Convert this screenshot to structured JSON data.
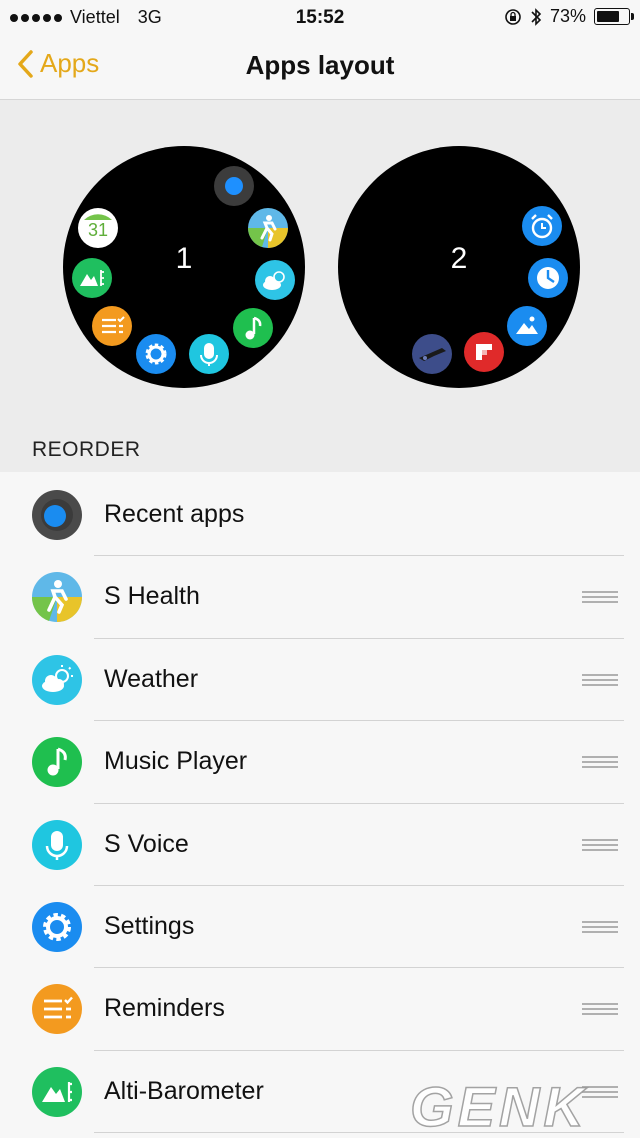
{
  "status_bar": {
    "carrier": "Viettel",
    "network": "3G",
    "time": "15:52",
    "battery": "73%",
    "battery_level": 0.73
  },
  "nav": {
    "back_label": "Apps",
    "title": "Apps layout"
  },
  "watches": [
    {
      "page": "1"
    },
    {
      "page": "2"
    }
  ],
  "section_header": "REORDER",
  "calendar_day": "31",
  "apps": [
    {
      "label": "Recent apps",
      "icon": "recent-apps-icon",
      "color": "#4a4a4a",
      "reorderable": false
    },
    {
      "label": "S Health",
      "icon": "s-health-icon",
      "color": "#5fb8e8",
      "reorderable": true
    },
    {
      "label": "Weather",
      "icon": "weather-icon",
      "color": "#2ec4e6",
      "reorderable": true
    },
    {
      "label": "Music Player",
      "icon": "music-player-icon",
      "color": "#1fbf4f",
      "reorderable": true
    },
    {
      "label": "S Voice",
      "icon": "s-voice-icon",
      "color": "#1fc6e0",
      "reorderable": true
    },
    {
      "label": "Settings",
      "icon": "settings-icon",
      "color": "#1a8cf0",
      "reorderable": true
    },
    {
      "label": "Reminders",
      "icon": "reminders-icon",
      "color": "#f39a1f",
      "reorderable": true
    },
    {
      "label": "Alti-Barometer",
      "icon": "alti-barometer-icon",
      "color": "#1fbf5f",
      "reorderable": true
    }
  ],
  "watermark": "GENK"
}
